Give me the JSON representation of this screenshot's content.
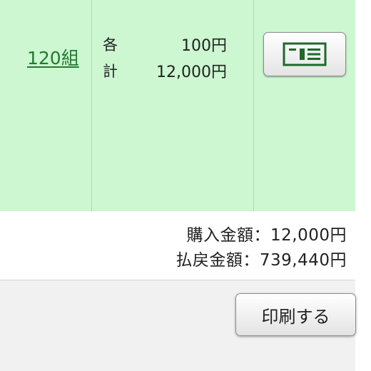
{
  "row": {
    "count_link": "120組",
    "unit_label": "各",
    "unit_value": "100円",
    "total_label": "計",
    "total_value": "12,000円",
    "ticket_button_icon": "ticket-icon"
  },
  "summary": {
    "purchase_line": "購入金額：12,000円",
    "refund_line": "払戻金額：739,440円"
  },
  "footer": {
    "print_button_label": "印刷する"
  },
  "colors": {
    "row_background": "#ccf7d1",
    "link_green": "#237a2e",
    "icon_green": "#1e6a2a"
  }
}
